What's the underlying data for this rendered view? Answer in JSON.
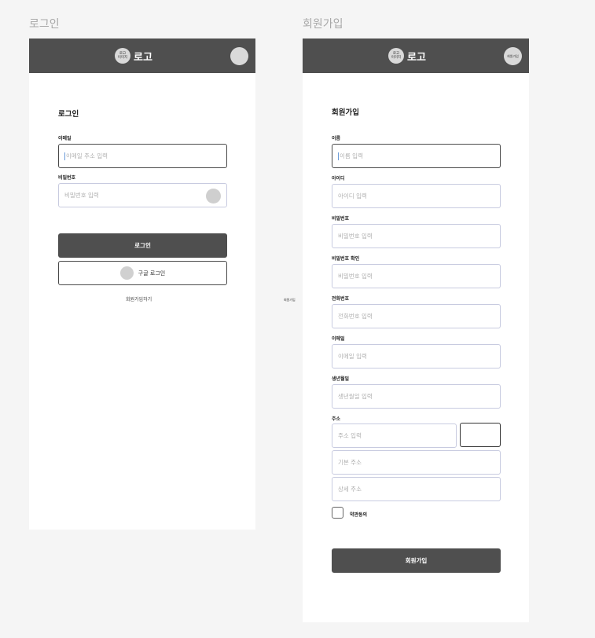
{
  "login_frame": {
    "frame_title": "로그인",
    "header": {
      "logo_line1": "로고",
      "logo_line2": "이미지",
      "logo_text": "로고"
    },
    "heading": "로그인",
    "email": {
      "label": "이메일",
      "placeholder": "이메일 주소 입력"
    },
    "password": {
      "label": "비밀번호",
      "placeholder": "비밀번호 입력"
    },
    "login_button": "로그인",
    "google_button": "구글 로그인",
    "signup_link": "회원가입하기"
  },
  "signup_frame": {
    "frame_title": "회원가입",
    "header": {
      "logo_line1": "로고",
      "logo_line2": "이미지",
      "logo_text": "로고",
      "header_circle_text": "회원가입"
    },
    "heading": "회원가입",
    "fields": {
      "name": {
        "label": "이름",
        "placeholder": "이름 입력"
      },
      "id": {
        "label": "아이디",
        "placeholder": "아이디 입력"
      },
      "password": {
        "label": "비밀번호",
        "placeholder": "비밀번호 입력"
      },
      "password_confirm": {
        "label": "비밀번호 확인",
        "placeholder": "비밀번호 입력"
      },
      "phone": {
        "label": "전화번호",
        "placeholder": "전화번호 입력"
      },
      "email": {
        "label": "이메일",
        "placeholder": "이메일 입력"
      },
      "birth": {
        "label": "생년월일",
        "placeholder": "생년월일 입력"
      },
      "address": {
        "label": "주소",
        "placeholder": "주소 입력",
        "basic_placeholder": "기본 주소",
        "detail_placeholder": "상세 주소"
      }
    },
    "terms_label": "약관동의",
    "submit_button": "회원가입"
  },
  "side_note": "회원가입"
}
